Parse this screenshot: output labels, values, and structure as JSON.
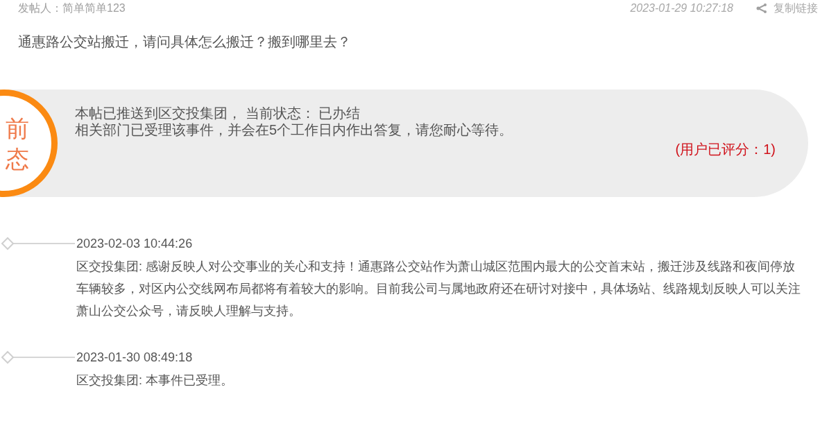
{
  "post": {
    "author_label": "发帖人：简单简单123",
    "time": "2023-01-29 10:27:18",
    "copy_link": "复制链接",
    "title": "通惠路公交站搬迁，请问具体怎么搬迁？搬到哪里去？"
  },
  "status": {
    "badge": [
      "前",
      "态"
    ],
    "line_1": "本帖已推送到区交投集团， 当前状态： 已办结",
    "line_2": "相关部门已受理该事件，并会在5个工作日内作出答复，请您耐心等待。",
    "rating": "(用户已评分：1)"
  },
  "timeline": [
    {
      "time": "2023-02-03 10:44:26",
      "text": "区交投集团: 感谢反映人对公交事业的关心和支持！通惠路公交站作为萧山城区范围内最大的公交首末站，搬迁涉及线路和夜间停放车辆较多，对区内公交线网布局都将有着较大的影响。目前我公司与属地政府还在研讨对接中，具体场站、线路规划反映人可以关注萧山公交公众号，请反映人理解与支持。"
    },
    {
      "time": "2023-01-30 08:49:18",
      "text": "区交投集团: 本事件已受理。"
    }
  ]
}
